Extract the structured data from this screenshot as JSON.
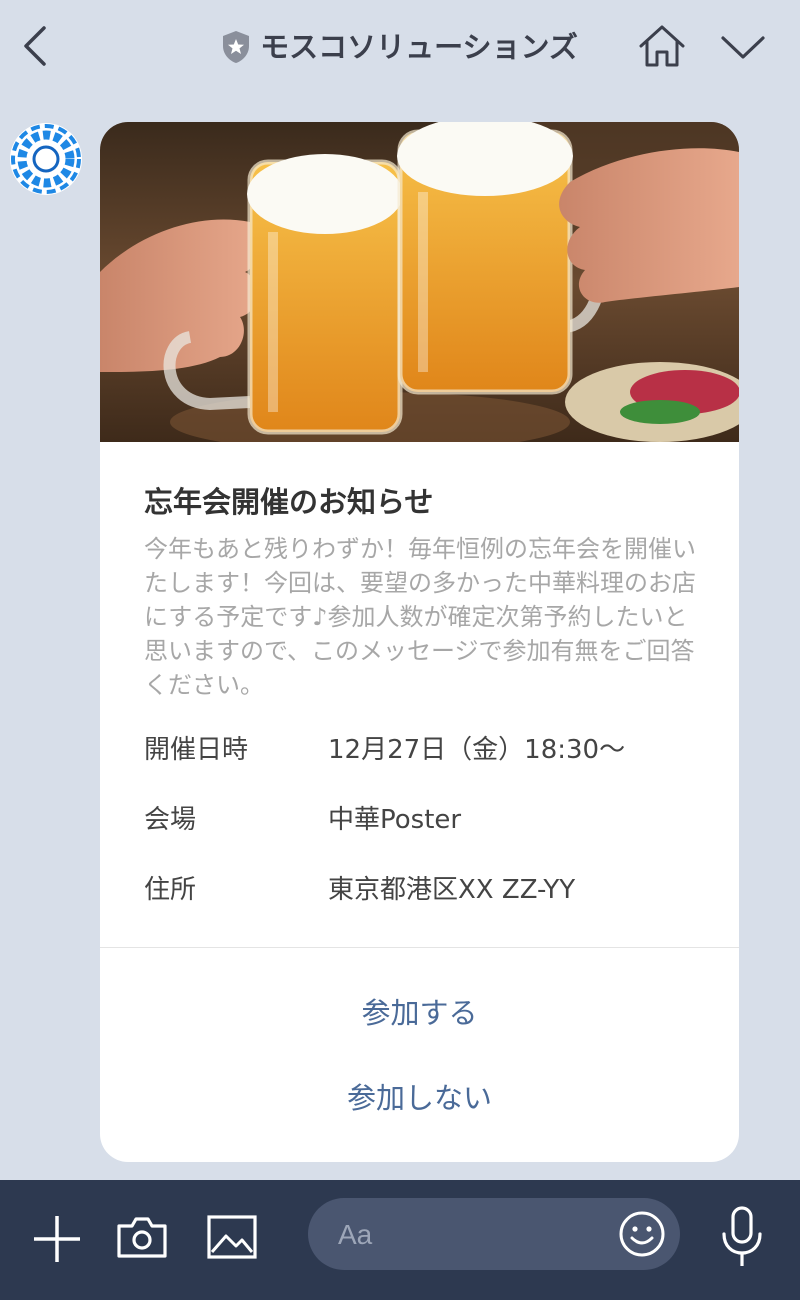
{
  "header": {
    "title": "モスコソリューションズ"
  },
  "message": {
    "title": "忘年会開催のお知らせ",
    "description": "今年もあと残りわずか！毎年恒例の忘年会を開催いたします！今回は、要望の多かった中華料理のお店にする予定です♪参加人数が確定次第予約したいと思いますので、このメッセージで参加有無をご回答ください。",
    "details": [
      {
        "label": "開催日時",
        "value": "12月27日（金）18:30〜"
      },
      {
        "label": "会場",
        "value": "中華Poster"
      },
      {
        "label": "住所",
        "value": "東京都港区XX ZZ-YY"
      }
    ],
    "actions": {
      "join": "参加する",
      "decline": "参加しない"
    }
  },
  "footer": {
    "input_placeholder": "Aa"
  },
  "icons": [
    "back-icon",
    "shield-icon",
    "home-icon",
    "chevron-down-icon",
    "plus-icon",
    "camera-icon",
    "image-icon",
    "emoji-icon",
    "microphone-icon"
  ],
  "colors": {
    "background": "#d7dee9",
    "footer": "#2d3950",
    "action_text": "#4a6a98",
    "description_text": "#a7a7a7"
  }
}
